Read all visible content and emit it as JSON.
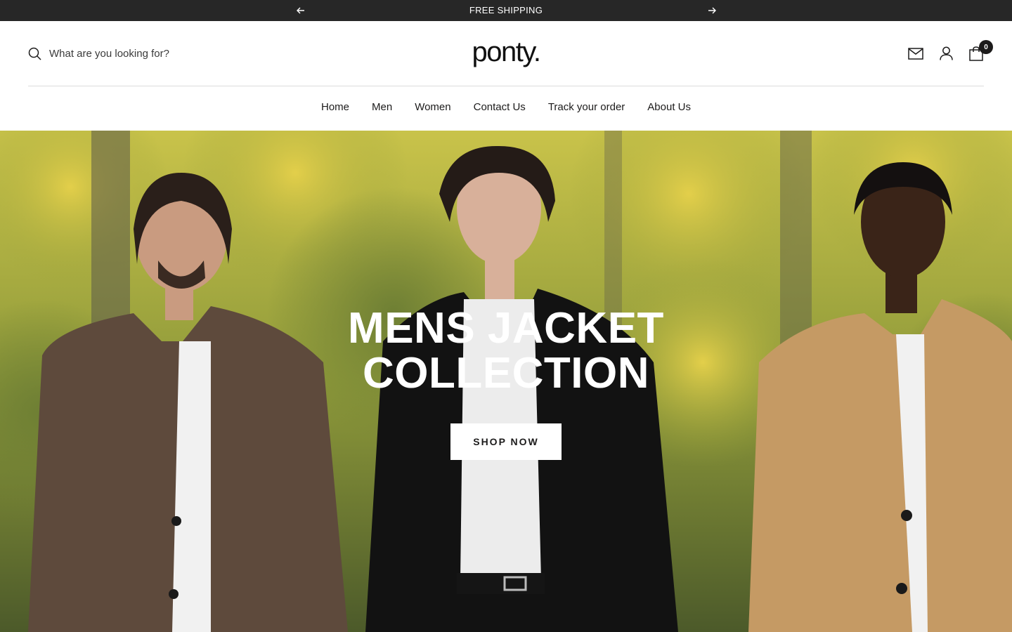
{
  "announcement": {
    "text": "FREE SHIPPING",
    "prev_icon": "arrow-left-icon",
    "next_icon": "arrow-right-icon"
  },
  "header": {
    "search_placeholder": "What are you looking for?",
    "logo_text": "ponty.",
    "cart_count": "0",
    "icons": [
      "search-icon",
      "mail-icon",
      "user-icon",
      "cart-icon"
    ]
  },
  "nav": {
    "items": [
      {
        "label": "Home"
      },
      {
        "label": "Men"
      },
      {
        "label": "Women"
      },
      {
        "label": "Contact Us"
      },
      {
        "label": "Track your order"
      },
      {
        "label": "About Us"
      }
    ]
  },
  "hero": {
    "title_line1": "MENS JACKET",
    "title_line2": "COLLECTION",
    "button_label": "SHOP NOW"
  },
  "colors": {
    "announcement_bg": "#272727",
    "text": "#1c1b1b",
    "button_bg": "#ffffff"
  }
}
